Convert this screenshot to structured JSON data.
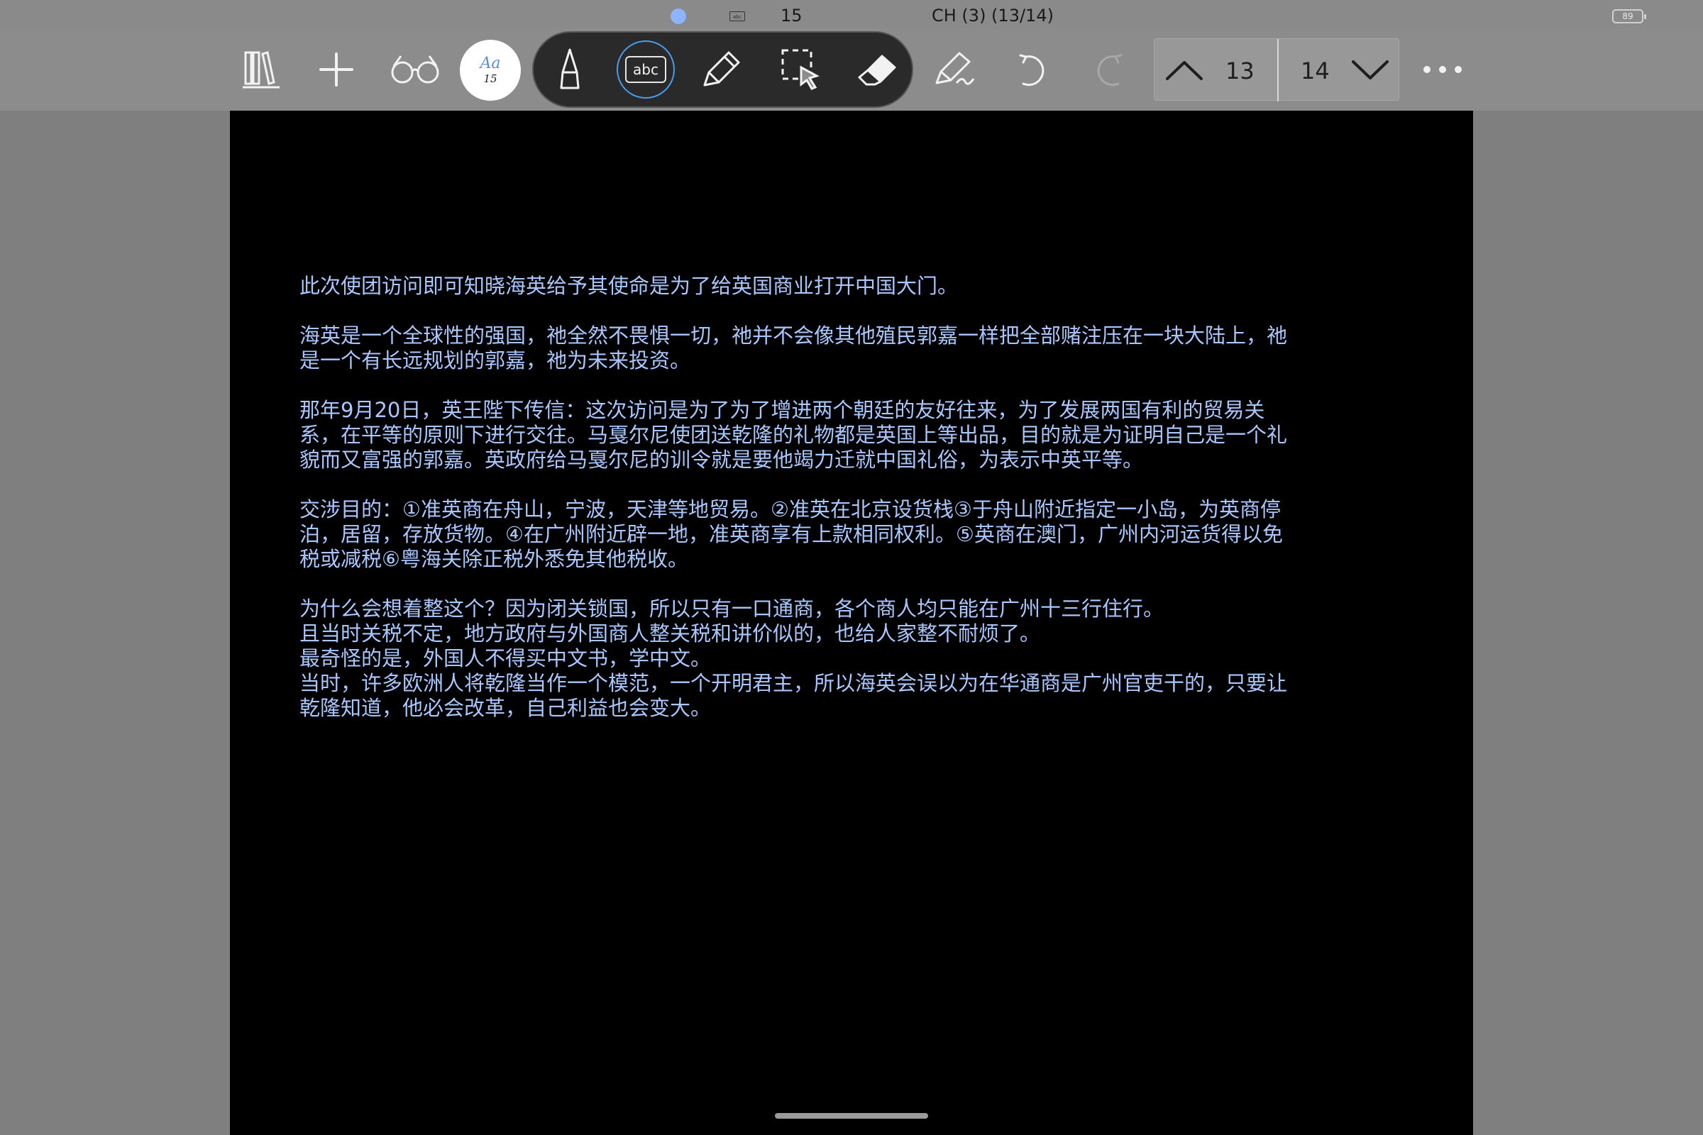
{
  "status_bar": {
    "mini_icon_text": "abc",
    "page_counter": "15",
    "document_title": "CH (3) (13/14)",
    "battery": "89"
  },
  "toolbar": {
    "icons": [
      "library-icon",
      "add-icon",
      "reading-glasses-icon",
      "font-size-icon",
      "pen-icon",
      "text-box-icon",
      "highlighter-icon",
      "selection-icon",
      "eraser-icon",
      "signature-icon",
      "undo-icon",
      "redo-icon",
      "page-up-icon",
      "page-down-icon",
      "more-icon"
    ],
    "font_sample": "Aa",
    "font_size": "15",
    "text_tool_label": "abc",
    "page_prev": "13",
    "page_next": "14"
  },
  "document": {
    "paragraphs": [
      "此次使团访问即可知晓海英给予其使命是为了给英国商业打开中国大门。",
      "海英是一个全球性的强国，祂全然不畏惧一切，祂并不会像其他殖民郭嘉一样把全部赌注压在一块大陆上，祂是一个有长远规划的郭嘉，祂为未来投资。",
      "那年9月20日，英王陛下传信：这次访问是为了为了增进两个朝廷的友好往来，为了发展两国有利的贸易关系，在平等的原则下进行交往。马戛尔尼使团送乾隆的礼物都是英国上等出品，目的就是为证明自己是一个礼貌而又富强的郭嘉。英政府给马戛尔尼的训令就是要他竭力迁就中国礼俗，为表示中英平等。",
      "交涉目的：①准英商在舟山，宁波，天津等地贸易。②准英在北京设货栈③于舟山附近指定一小岛，为英商停泊，居留，存放货物。④在广州附近辟一地，准英商享有上款相同权利。⑤英商在澳门，广州内河运货得以免税或减税⑥粤海关除正税外悉免其他税收。"
    ],
    "last_block_lines": [
      "为什么会想着整这个？因为闭关锁国，所以只有一口通商，各个商人均只能在广州十三行住行。",
      "且当时关税不定，地方政府与外国商人整关税和讲价似的，也给人家整不耐烦了。",
      "最奇怪的是，外国人不得买中文书，学中文。",
      "当时，许多欧洲人将乾隆当作一个模范，一个开明君主，所以海英会误以为在华通商是广州官吏干的，只要让乾隆知道，他必会改革，自己利益也会变大。"
    ]
  },
  "colors": {
    "text": "#a9c7ff",
    "page_background": "#000000",
    "chrome": "#8c8c8c",
    "accent": "#4a9cf0"
  }
}
